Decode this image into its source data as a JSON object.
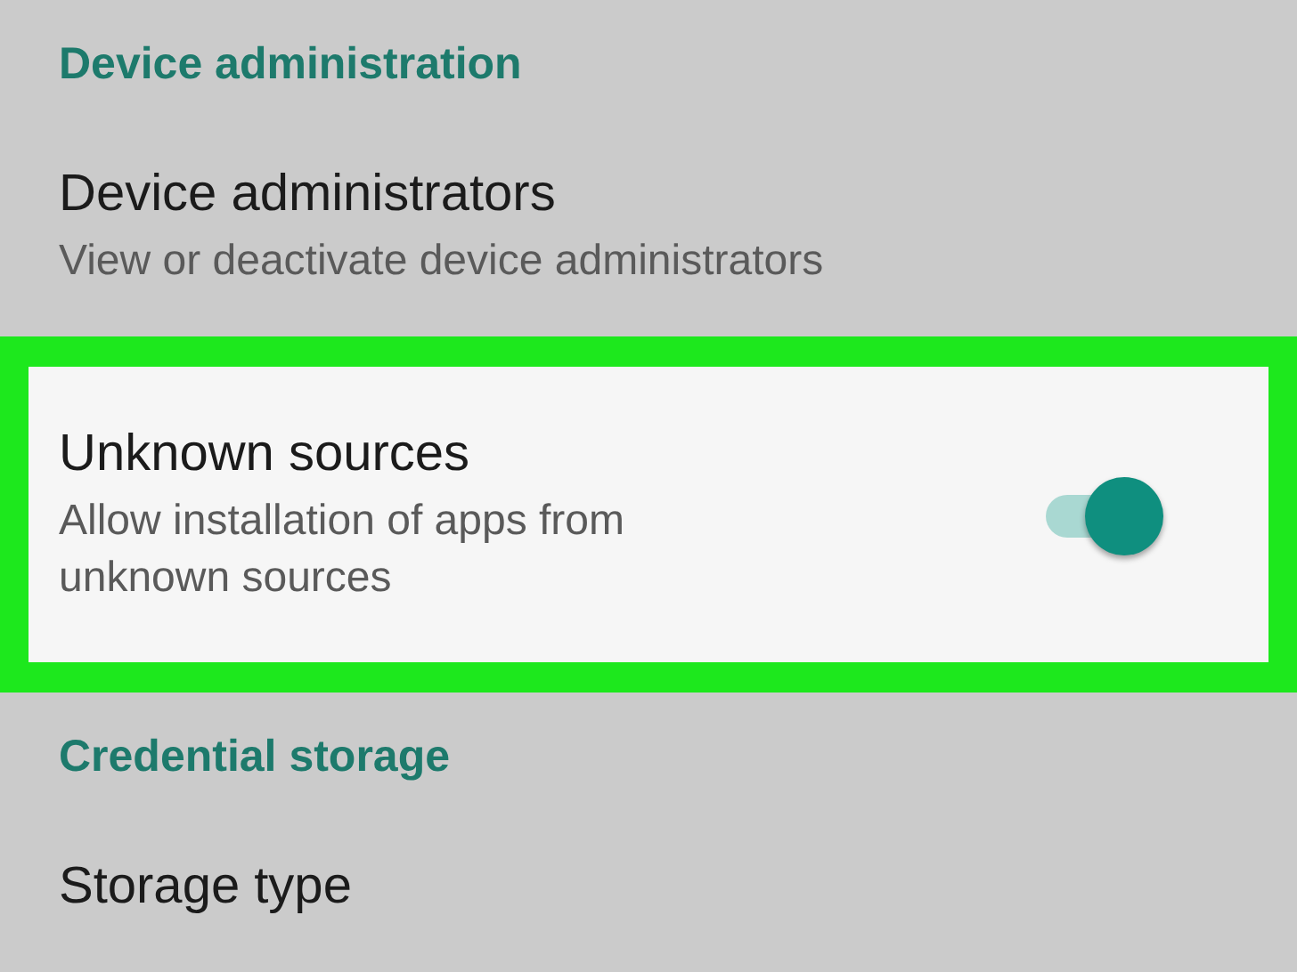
{
  "sections": [
    {
      "header": "Device administration",
      "items": [
        {
          "kind": "plain",
          "title": "Device administrators",
          "subtitle": "View or deactivate device administrators",
          "highlighted": false
        },
        {
          "kind": "toggle",
          "title": "Unknown sources",
          "subtitle": "Allow installation of apps from unknown sources",
          "on": true,
          "highlighted": true
        }
      ]
    },
    {
      "header": "Credential storage",
      "items": [
        {
          "kind": "plain",
          "title": "Storage type",
          "highlighted": false
        }
      ]
    }
  ]
}
